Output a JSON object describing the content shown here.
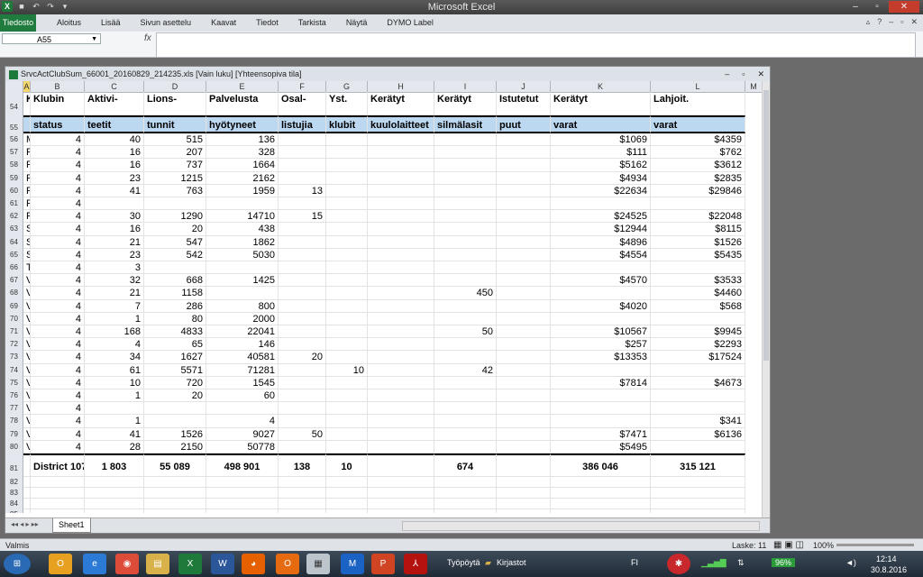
{
  "app": {
    "title": "Microsoft Excel"
  },
  "ribbon": {
    "file_tab": "Tiedosto",
    "tabs": [
      "Aloitus",
      "Lisää",
      "Sivun asettelu",
      "Kaavat",
      "Tiedot",
      "Tarkista",
      "Näytä",
      "DYMO Label"
    ]
  },
  "formula_bar": {
    "name_box": "A55",
    "fx_label": "fx",
    "formula": ""
  },
  "workbook": {
    "title": "SrvcActClubSum_66001_20160829_214235.xls  [Vain luku]  [Yhteensopiva tila]",
    "columns": [
      "A",
      "B",
      "C",
      "D",
      "E",
      "F",
      "G",
      "H",
      "I",
      "J",
      "K",
      "L",
      "M"
    ],
    "header_row_54": {
      "num": "54",
      "cells": [
        "K",
        "Klubin",
        "Aktivi-",
        "Lions-",
        "Palvelusta",
        "Osal-",
        "Yst.",
        "Kerätyt",
        "Kerätyt",
        "Istutetut",
        "Kerätyt",
        "Lahjoit."
      ]
    },
    "header_row_55": {
      "num": "55",
      "cells": [
        "",
        "status",
        "teetit",
        "tunnit",
        "hyötyneet",
        "listujia",
        "klubit",
        "kuulolaitteet",
        "silmälasit",
        "puut",
        "varat",
        "varat"
      ]
    },
    "data_rows": [
      {
        "n": "56",
        "a": "M",
        "b": "4",
        "c": "40",
        "d": "515",
        "e": "136",
        "f": "",
        "g": "",
        "h": "",
        "i": "",
        "j": "",
        "k": "$1069",
        "l": "$4359"
      },
      {
        "n": "57",
        "a": "F",
        "b": "4",
        "c": "16",
        "d": "207",
        "e": "328",
        "f": "",
        "g": "",
        "h": "",
        "i": "",
        "j": "",
        "k": "$111",
        "l": "$762"
      },
      {
        "n": "58",
        "a": "F",
        "b": "4",
        "c": "16",
        "d": "737",
        "e": "1664",
        "f": "",
        "g": "",
        "h": "",
        "i": "",
        "j": "",
        "k": "$5162",
        "l": "$3612"
      },
      {
        "n": "59",
        "a": "F",
        "b": "4",
        "c": "23",
        "d": "1215",
        "e": "2162",
        "f": "",
        "g": "",
        "h": "",
        "i": "",
        "j": "",
        "k": "$4934",
        "l": "$2835"
      },
      {
        "n": "60",
        "a": "F",
        "b": "4",
        "c": "41",
        "d": "763",
        "e": "1959",
        "f": "13",
        "g": "",
        "h": "",
        "i": "",
        "j": "",
        "k": "$22634",
        "l": "$29846"
      },
      {
        "n": "61",
        "a": "F",
        "b": "4",
        "c": "",
        "d": "",
        "e": "",
        "f": "",
        "g": "",
        "h": "",
        "i": "",
        "j": "",
        "k": "",
        "l": ""
      },
      {
        "n": "62",
        "a": "F",
        "b": "4",
        "c": "30",
        "d": "1290",
        "e": "14710",
        "f": "15",
        "g": "",
        "h": "",
        "i": "",
        "j": "",
        "k": "$24525",
        "l": "$22048"
      },
      {
        "n": "63",
        "a": "S",
        "b": "4",
        "c": "16",
        "d": "20",
        "e": "438",
        "f": "",
        "g": "",
        "h": "",
        "i": "",
        "j": "",
        "k": "$12944",
        "l": "$8115"
      },
      {
        "n": "64",
        "a": "S",
        "b": "4",
        "c": "21",
        "d": "547",
        "e": "1862",
        "f": "",
        "g": "",
        "h": "",
        "i": "",
        "j": "",
        "k": "$4896",
        "l": "$1526"
      },
      {
        "n": "65",
        "a": "S",
        "b": "4",
        "c": "23",
        "d": "542",
        "e": "5030",
        "f": "",
        "g": "",
        "h": "",
        "i": "",
        "j": "",
        "k": "$4554",
        "l": "$5435"
      },
      {
        "n": "66",
        "a": "T",
        "b": "4",
        "c": "3",
        "d": "",
        "e": "",
        "f": "",
        "g": "",
        "h": "",
        "i": "",
        "j": "",
        "k": "",
        "l": ""
      },
      {
        "n": "67",
        "a": "V",
        "b": "4",
        "c": "32",
        "d": "668",
        "e": "1425",
        "f": "",
        "g": "",
        "h": "",
        "i": "",
        "j": "",
        "k": "$4570",
        "l": "$3533"
      },
      {
        "n": "68",
        "a": "V",
        "b": "4",
        "c": "21",
        "d": "1158",
        "e": "",
        "f": "",
        "g": "",
        "h": "",
        "i": "450",
        "j": "",
        "k": "",
        "l": "$4460"
      },
      {
        "n": "69",
        "a": "V",
        "b": "4",
        "c": "7",
        "d": "286",
        "e": "800",
        "f": "",
        "g": "",
        "h": "",
        "i": "",
        "j": "",
        "k": "$4020",
        "l": "$568"
      },
      {
        "n": "70",
        "a": "V",
        "b": "4",
        "c": "1",
        "d": "80",
        "e": "2000",
        "f": "",
        "g": "",
        "h": "",
        "i": "",
        "j": "",
        "k": "",
        "l": ""
      },
      {
        "n": "71",
        "a": "V",
        "b": "4",
        "c": "168",
        "d": "4833",
        "e": "22041",
        "f": "",
        "g": "",
        "h": "",
        "i": "50",
        "j": "",
        "k": "$10567",
        "l": "$9945"
      },
      {
        "n": "72",
        "a": "V",
        "b": "4",
        "c": "4",
        "d": "65",
        "e": "146",
        "f": "",
        "g": "",
        "h": "",
        "i": "",
        "j": "",
        "k": "$257",
        "l": "$2293"
      },
      {
        "n": "73",
        "a": "V",
        "b": "4",
        "c": "34",
        "d": "1627",
        "e": "40581",
        "f": "20",
        "g": "",
        "h": "",
        "i": "",
        "j": "",
        "k": "$13353",
        "l": "$17524"
      },
      {
        "n": "74",
        "a": "V",
        "b": "4",
        "c": "61",
        "d": "5571",
        "e": "71281",
        "f": "",
        "g": "10",
        "h": "",
        "i": "42",
        "j": "",
        "k": "",
        "l": ""
      },
      {
        "n": "75",
        "a": "V",
        "b": "4",
        "c": "10",
        "d": "720",
        "e": "1545",
        "f": "",
        "g": "",
        "h": "",
        "i": "",
        "j": "",
        "k": "$7814",
        "l": "$4673"
      },
      {
        "n": "76",
        "a": "V",
        "b": "4",
        "c": "1",
        "d": "20",
        "e": "60",
        "f": "",
        "g": "",
        "h": "",
        "i": "",
        "j": "",
        "k": "",
        "l": ""
      },
      {
        "n": "77",
        "a": "V",
        "b": "4",
        "c": "",
        "d": "",
        "e": "",
        "f": "",
        "g": "",
        "h": "",
        "i": "",
        "j": "",
        "k": "",
        "l": ""
      },
      {
        "n": "78",
        "a": "V",
        "b": "4",
        "c": "1",
        "d": "",
        "e": "4",
        "f": "",
        "g": "",
        "h": "",
        "i": "",
        "j": "",
        "k": "",
        "l": "$341"
      },
      {
        "n": "79",
        "a": "V",
        "b": "4",
        "c": "41",
        "d": "1526",
        "e": "9027",
        "f": "50",
        "g": "",
        "h": "",
        "i": "",
        "j": "",
        "k": "$7471",
        "l": "$6136"
      },
      {
        "n": "80",
        "a": "V",
        "b": "4",
        "c": "28",
        "d": "2150",
        "e": "50778",
        "f": "",
        "g": "",
        "h": "",
        "i": "",
        "j": "",
        "k": "$5495",
        "l": ""
      }
    ],
    "total_row": {
      "n": "81",
      "b": "District 107",
      "c": "1 803",
      "d": "55 089",
      "e": "498 901",
      "f": "138",
      "g": "10",
      "i": "674",
      "k": "386 046",
      "l": "315 121"
    },
    "empty_rows": [
      "82",
      "83",
      "84",
      "85",
      "86"
    ],
    "sheet_tab": "Sheet1"
  },
  "status": {
    "ready": "Valmis",
    "count": "Laske: 11",
    "zoom": "100%"
  },
  "taskbar": {
    "desktop": "Työpöytä",
    "folder": "Kirjastot",
    "lang": "FI",
    "battery": "96%",
    "time": "12:14",
    "date": "30.8.2016"
  }
}
